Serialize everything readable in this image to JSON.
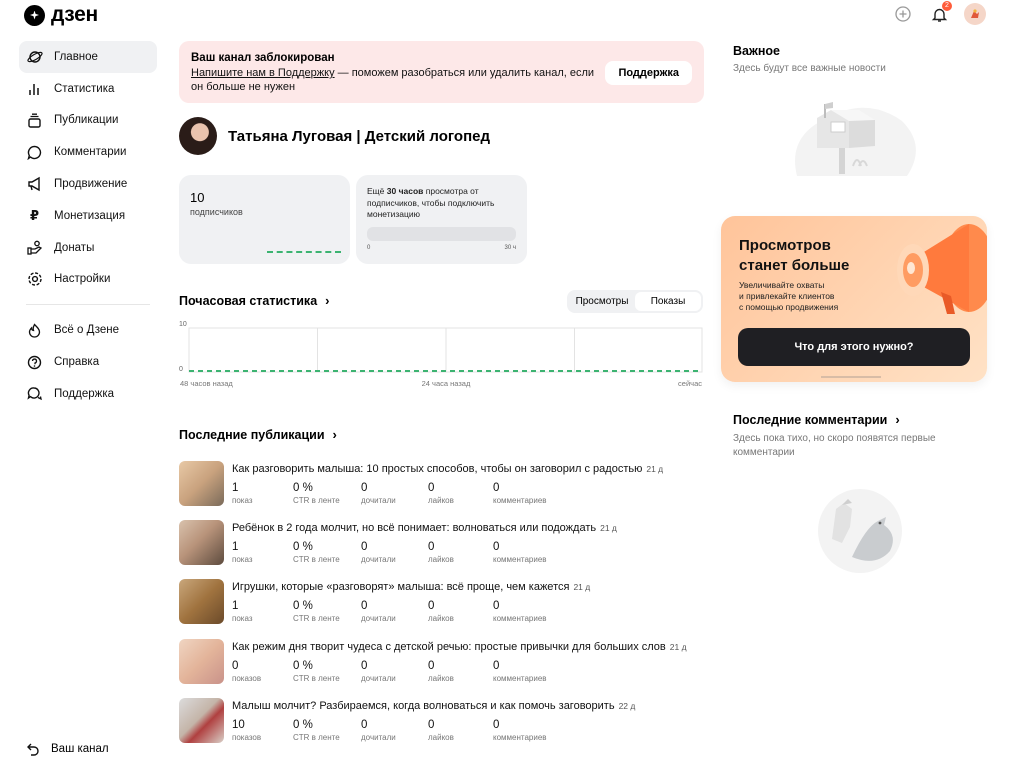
{
  "header": {
    "logo_text": "дзен",
    "icons": [
      "add-icon",
      "bell-icon",
      "avatar"
    ],
    "notification_count": "2"
  },
  "sidebar": {
    "items": [
      {
        "label": "Главное",
        "icon": "planet-icon",
        "active": true
      },
      {
        "label": "Статистика",
        "icon": "bar-chart-icon"
      },
      {
        "label": "Публикации",
        "icon": "stack-icon"
      },
      {
        "label": "Комментарии",
        "icon": "comment-icon"
      },
      {
        "label": "Продвижение",
        "icon": "megaphone-icon"
      },
      {
        "label": "Монетизация",
        "icon": "ruble-icon"
      },
      {
        "label": "Донаты",
        "icon": "donate-icon"
      },
      {
        "label": "Настройки",
        "icon": "gear-icon"
      }
    ],
    "secondary": [
      {
        "label": "Всё о Дзене",
        "icon": "flame-icon"
      },
      {
        "label": "Справка",
        "icon": "help-icon"
      },
      {
        "label": "Поддержка",
        "icon": "chat-icon"
      }
    ],
    "channel_link": "Ваш канал"
  },
  "blocked": {
    "title": "Ваш канал заблокирован",
    "link": "Напишите нам в Поддержку",
    "text": " — поможем разобраться или удалить канал, если он больше не нужен",
    "button": "Поддержка"
  },
  "profile": {
    "name": "Татьяна Луговая | Детский логопед"
  },
  "subscribers": {
    "count": "10",
    "label": "подписчиков"
  },
  "monetization": {
    "text_before": "Ещё ",
    "hours": "30 часов",
    "text_after": " просмотра от подписчиков, чтобы подключить монетизацию",
    "scale_min": "0",
    "scale_max": "30 ч",
    "progress": 0
  },
  "hourly": {
    "title": "Почасовая статистика",
    "tabs": [
      "Просмотры",
      "Показы"
    ],
    "selected_tab": "Показы"
  },
  "chart_data": {
    "type": "line",
    "title": "Почасовая статистика",
    "y_ticks": [
      "10",
      "0"
    ],
    "x_ticks": [
      "48 часов назад",
      "24 часа назад",
      "сейчас"
    ],
    "ylim": [
      0,
      10
    ],
    "series": [
      {
        "values": [
          0,
          0,
          0,
          0,
          0,
          0,
          0,
          0
        ]
      }
    ],
    "grid": true
  },
  "publications": {
    "title": "Последние публикации",
    "metric_labels": [
      "CTR в ленте",
      "дочитали",
      "лайков",
      "комментариев"
    ],
    "items": [
      {
        "title": "Как разговорить малыша: 10 простых способов, чтобы он заговорил с радостью",
        "date": "21 д",
        "shows": "1",
        "shows_label": "показ",
        "ctr": "0 %",
        "read": "0",
        "likes": "0",
        "comments": "0"
      },
      {
        "title": "Ребёнок в 2 года молчит, но всё понимает: волноваться или подождать",
        "date": "21 д",
        "shows": "1",
        "shows_label": "показ",
        "ctr": "0 %",
        "read": "0",
        "likes": "0",
        "comments": "0"
      },
      {
        "title": "Игрушки, которые «разговорят» малыша: всё проще, чем кажется",
        "date": "21 д",
        "shows": "1",
        "shows_label": "показ",
        "ctr": "0 %",
        "read": "0",
        "likes": "0",
        "comments": "0"
      },
      {
        "title": "Как режим дня творит чудеса с детской речью: простые привычки для больших слов",
        "date": "21 д",
        "shows": "0",
        "shows_label": "показов",
        "ctr": "0 %",
        "read": "0",
        "likes": "0",
        "comments": "0"
      },
      {
        "title": "Малыш молчит? Разбираемся, когда волноваться и как помочь заговорить",
        "date": "22 д",
        "shows": "10",
        "shows_label": "показов",
        "ctr": "0 %",
        "read": "0",
        "likes": "0",
        "comments": "0"
      }
    ]
  },
  "important": {
    "title": "Важное",
    "subtitle": "Здесь будут все важные новости"
  },
  "promo": {
    "title_line1": "Просмотров",
    "title_line2": "станет больше",
    "text_line1": "Увеличивайте охваты",
    "text_line2": "и привлекайте клиентов",
    "text_line3": "с помощью продвижения",
    "button": "Что для этого нужно?"
  },
  "comments": {
    "title": "Последние комментарии",
    "subtitle": "Здесь пока тихо, но скоро появятся первые комментарии"
  },
  "colors": {
    "accent_orange": "#ff7a3d",
    "alert_bg": "#fde8e8",
    "card_bg": "#f0f1f3",
    "chart_green": "#3cb371"
  }
}
